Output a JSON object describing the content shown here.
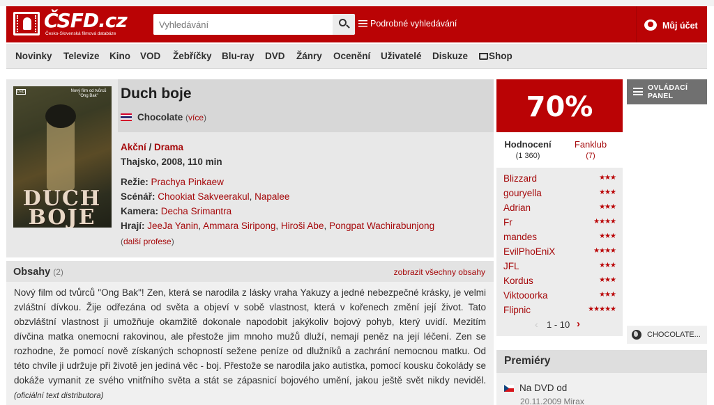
{
  "header": {
    "logo_text": "ČSFD.cz",
    "logo_sub": "Česko-Slovenská filmová databáze",
    "search_placeholder": "Vyhledávání",
    "advanced_search": "Podrobné vyhledávání",
    "account": "Můj účet"
  },
  "nav": {
    "items": [
      "Novinky",
      "Televize",
      "Kino",
      "VOD",
      "Žebříčky",
      "Blu-ray",
      "DVD",
      "Žánry",
      "Ocenění",
      "Uživatelé",
      "Diskuze",
      "Shop"
    ]
  },
  "film": {
    "title": "Duch boje",
    "alt_title": "Chocolate",
    "alt_more": "více",
    "poster_title": "DUCH BOJE",
    "poster_tag": "Nový film od tvůrců \"Ong Bak\"",
    "poster_dvd": "DVD",
    "genres": [
      "Akční",
      "Drama"
    ],
    "origin": "Thajsko, 2008, 110 min",
    "crew": {
      "directing_label": "Režie:",
      "directing": [
        "Prachya Pinkaew"
      ],
      "writing_label": "Scénář:",
      "writing": [
        "Chookiat Sakveerakul",
        "Napalee"
      ],
      "camera_label": "Kamera:",
      "camera": [
        "Decha Srimantra"
      ],
      "cast_label": "Hrají:",
      "cast": [
        "JeeJa Yanin",
        "Ammara Siripong",
        "Hiroši Abe",
        "Pongpat Wachirabunjong"
      ]
    },
    "more_professions": "další profese"
  },
  "plot": {
    "title": "Obsahy",
    "count": "(2)",
    "show_all": "zobrazit všechny obsahy",
    "text": "Nový film od tvůrců \"Ong Bak\"! Zen, která se narodila z lásky vraha Yakuzy a jedné nebezpečné krásky, je velmi zvláštní dívkou. Žije odřezána od světa a objeví v sobě vlastnost, která v kořenech změní její život. Tato obzvláštní vlastnost ji umožňuje okamžitě dokonale napodobit jakýkoliv bojový pohyb, který uvidí. Mezitím dívčina matka onemocní rakovinou, ale přestože jim mnoho mužů dluží, nemají peněz na její léčení. Zen se rozhodne, že pomocí nově získaných schopností sežene peníze od dlužníků a zachrání nemocnou matku. Od této chvíle ji udržuje při životě jen jediná věc - boj. Přestože se narodila jako autistka, pomocí kousku čokolády se dokáže vymanit ze svého vnitřního světa a stát se zápasnicí bojového umění, jakou ještě svět nikdy neviděl.",
    "source": "(oficiální text distributora)"
  },
  "rating": {
    "percent": "70%",
    "tab_ratings": "Hodnocení",
    "tab_ratings_count": "(1 360)",
    "tab_fanclub": "Fanklub",
    "tab_fanclub_count": "(7)",
    "users": [
      {
        "name": "Blizzard",
        "stars": "★★★"
      },
      {
        "name": "gouryella",
        "stars": "★★★"
      },
      {
        "name": "Adrian",
        "stars": "★★★"
      },
      {
        "name": "Fr",
        "stars": "★★★★"
      },
      {
        "name": "mandes",
        "stars": "★★★"
      },
      {
        "name": "EvilPhoEniX",
        "stars": "★★★★"
      },
      {
        "name": "JFL",
        "stars": "★★★"
      },
      {
        "name": "Kordus",
        "stars": "★★★"
      },
      {
        "name": "Viktooorka",
        "stars": "★★★"
      },
      {
        "name": "Flipnic",
        "stars": "★★★★★"
      }
    ],
    "pager": "1 - 10",
    "prev_icon": "‹",
    "next_icon": "›"
  },
  "sidebar": {
    "control_panel": "OVLÁDACÍ PANEL",
    "chocolate": "CHOCOLATE..."
  },
  "premieres": {
    "title": "Premiéry",
    "row_label": "Na DVD od",
    "row_date": "20.11.2009 Mirax"
  },
  "colors": {
    "brand_red": "#ba0305",
    "link_red": "#a5080a"
  }
}
